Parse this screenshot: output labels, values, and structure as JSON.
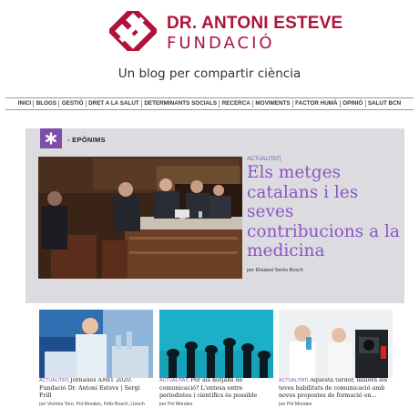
{
  "header": {
    "brand_line1": "DR. ANTONI ESTEVE",
    "brand_line2": "FUNDACIÓ",
    "tagline": "Un blog per compartir ciència",
    "brand_color": "#b0123a"
  },
  "nav": {
    "items": [
      "INICI",
      "BLOGS",
      "GESTIÓ",
      "DRET A LA SALUT",
      "DETERMINANTS SOCIALS",
      "RECERCA",
      "MOVIMENTS",
      "FACTOR HUMÀ",
      "OPINIÓ",
      "SALUT BCN"
    ]
  },
  "featured": {
    "section_label": "- EPÒNIMS",
    "badge_icon": "asterisk-icon",
    "accent_color": "#7d4faa",
    "category": "ACTUALITAT|",
    "title": "Els metges catalans i les seves contribucions a la medicina",
    "author": "per Elisabet Serés Bosch"
  },
  "cards": [
    {
      "category": "ACTUALITAT|",
      "title": "Jornades AMIT 2020. Fundació Dr. Antoni Esteve | Sergi Frill",
      "author": "per Victoria Toro, Pol Morales, Fèlix Bosch, Llonch"
    },
    {
      "category": "ACTUALITAT|",
      "title": "Per als mitjans de comunicació? L'entesa entre periodistes i científics és possible",
      "author": "per Pol Morales"
    },
    {
      "category": "ACTUALITAT|",
      "title": "Aquesta tardor, millora les teves habilitats de comunicació amb noves propostes de formació en...",
      "author": "per Pol Morales"
    }
  ]
}
